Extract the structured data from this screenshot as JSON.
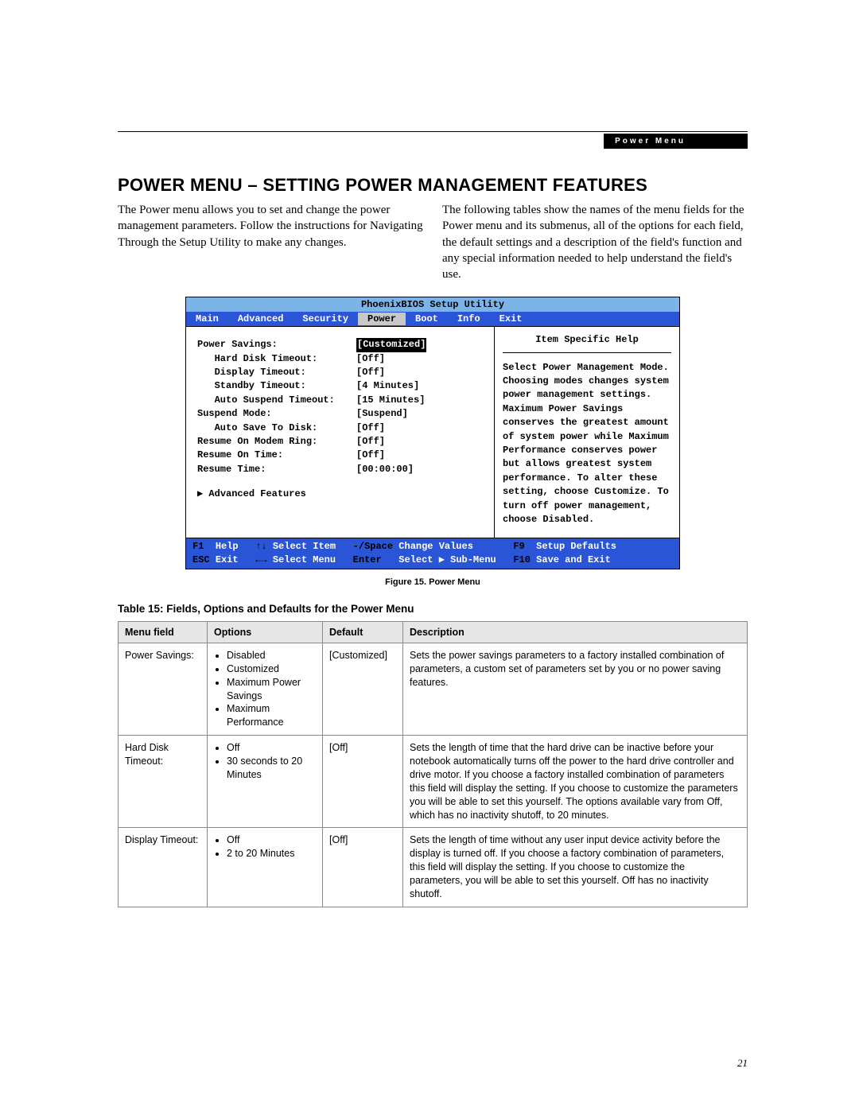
{
  "header_tag": "Power Menu",
  "title": "POWER MENU – SETTING POWER MANAGEMENT FEATURES",
  "intro_left": "The Power menu allows you to set and change the power management parameters. Follow the instructions for Navigating Through the Setup Utility to make any changes.",
  "intro_right": "The following tables show the names of the menu fields for the Power menu and its submenus, all of the options for each field, the default settings and a description of the field's function and any special information needed to help understand the field's use.",
  "bios": {
    "title": "PhoenixBIOS Setup Utility",
    "tabs": [
      "Main",
      "Advanced",
      "Security",
      "Power",
      "Boot",
      "Info",
      "Exit"
    ],
    "selected_tab": "Power",
    "rows": [
      {
        "label": "Power Savings:",
        "value": "[Customized]",
        "indent": 0,
        "hl": true
      },
      {
        "label": "Hard Disk Timeout:",
        "value": "[Off]",
        "indent": 1
      },
      {
        "label": "Display Timeout:",
        "value": "[Off]",
        "indent": 1
      },
      {
        "label": "Standby Timeout:",
        "value": "[4 Minutes]",
        "indent": 1
      },
      {
        "label": "Auto Suspend Timeout:",
        "value": "[15 Minutes]",
        "indent": 1
      },
      {
        "label": "",
        "value": "",
        "indent": 0
      },
      {
        "label": "Suspend Mode:",
        "value": "[Suspend]",
        "indent": 0
      },
      {
        "label": "Auto Save To Disk:",
        "value": "[Off]",
        "indent": 1
      },
      {
        "label": "",
        "value": "",
        "indent": 0
      },
      {
        "label": "Resume On Modem Ring:",
        "value": "[Off]",
        "indent": 0
      },
      {
        "label": "Resume On Time:",
        "value": "[Off]",
        "indent": 0
      },
      {
        "label": "Resume Time:",
        "value": "[00:00:00]",
        "indent": 0
      }
    ],
    "advanced": "▶ Advanced Features",
    "help_title": "Item Specific Help",
    "help_text": "Select Power Management Mode. Choosing modes changes system power management settings. Maximum Power Savings conserves the greatest amount of system power while Maximum Performance conserves power but allows greatest system performance. To alter these setting, choose Customize. To turn off power management, choose Disabled.",
    "footer": {
      "l1": {
        "k1": "F1",
        "v1": "Help",
        "k2": "↑↓",
        "v2": "Select Item",
        "k3": "-/Space",
        "v3": "Change Values",
        "k4": "F9",
        "v4": "Setup Defaults"
      },
      "l2": {
        "k1": "ESC",
        "v1": "Exit",
        "k2": "←→",
        "v2": "Select Menu",
        "k3": "Enter",
        "v3": "Select ▶ Sub-Menu",
        "k4": "F10",
        "v4": "Save and Exit"
      }
    }
  },
  "fig_caption": "Figure 15.  Power Menu",
  "table_caption": "Table 15: Fields, Options and Defaults for the Power Menu",
  "table": {
    "headers": [
      "Menu field",
      "Options",
      "Default",
      "Description"
    ],
    "rows": [
      {
        "field": "Power Savings:",
        "options": [
          "Disabled",
          "Customized",
          "Maximum Power Savings",
          "Maximum Performance"
        ],
        "default": "[Customized]",
        "desc": "Sets the power savings parameters to a factory installed combination of parameters, a custom set of parameters set by you or no power saving features."
      },
      {
        "field": "Hard Disk Timeout:",
        "options": [
          "Off",
          "30 seconds to 20 Minutes"
        ],
        "default": "[Off]",
        "desc": "Sets the length of time that the hard drive can be inactive before your notebook automatically turns off the power to the hard drive controller and drive motor. If you choose a factory installed combination of parameters this field will display the setting. If you choose to customize the parameters you will be able to set this yourself. The options available vary from Off, which has no inactivity shutoff, to 20 minutes."
      },
      {
        "field": "Display Timeout:",
        "options": [
          "Off",
          "2 to 20 Minutes"
        ],
        "default": "[Off]",
        "desc": "Sets the length of time without any user input device activity before the display is turned off. If you choose a factory combination of parameters, this field will display the setting. If you choose to customize the parameters, you will be able to set this yourself. Off has no inactivity shutoff."
      }
    ]
  },
  "page_number": "21"
}
